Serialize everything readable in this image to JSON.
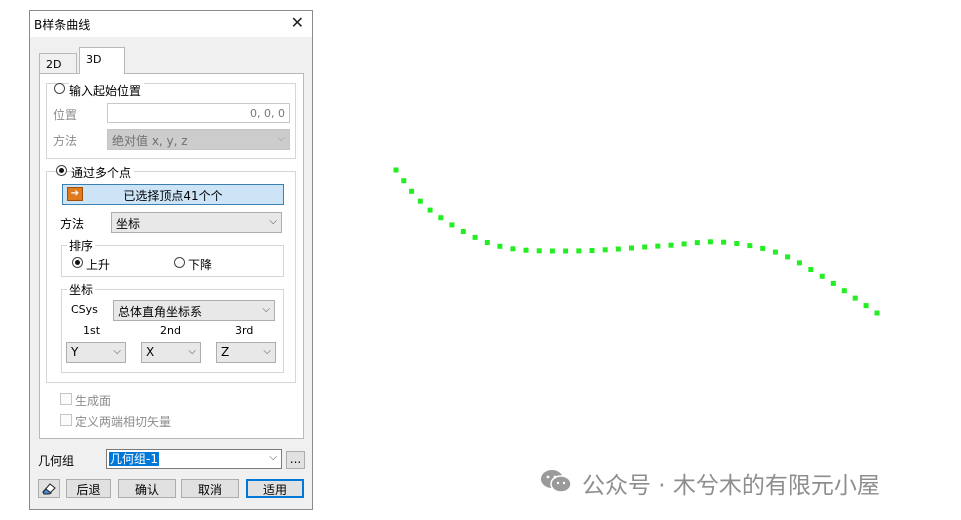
{
  "dialog": {
    "title": "B样条曲线",
    "close_glyph": "✕",
    "tabs": [
      {
        "label": "2D",
        "active": false
      },
      {
        "label": "3D",
        "active": true
      }
    ],
    "start_position": {
      "radio_label": "输入起始位置",
      "selected": false,
      "position_label": "位置",
      "position_value": "0, 0, 0",
      "method_label": "方法",
      "method_value": "绝对值 x, y, z"
    },
    "multi_point": {
      "radio_label": "通过多个点",
      "selected": true,
      "select_button_label": "已选择顶点41个个",
      "select_icon": "arrow-select-icon",
      "method_label": "方法",
      "method_value": "坐标"
    },
    "order": {
      "group_label": "排序",
      "ascending_label": "上升",
      "ascending_selected": true,
      "descending_label": "下降",
      "descending_selected": false
    },
    "coords": {
      "group_label": "坐标",
      "csys_label": "CSys",
      "csys_value": "总体直角坐标系",
      "col1_label": "1st",
      "col2_label": "2nd",
      "col3_label": "3rd",
      "col1_value": "Y",
      "col2_value": "X",
      "col3_value": "Z"
    },
    "options": {
      "generate_face_label": "生成面",
      "generate_face_checked": false,
      "tangent_label": "定义两端相切矢量",
      "tangent_checked": false
    },
    "geometry_group": {
      "label": "几何组",
      "value": "几何组-1",
      "browse_label": "..."
    },
    "buttons": {
      "back": "后退",
      "ok": "确认",
      "cancel": "取消",
      "apply": "适用"
    }
  },
  "canvas": {
    "point_color": "#22ee22",
    "point_count": 41
  },
  "watermark": {
    "text": "公众号 · 木兮木的有限元小屋",
    "icon": "wechat-icon"
  }
}
